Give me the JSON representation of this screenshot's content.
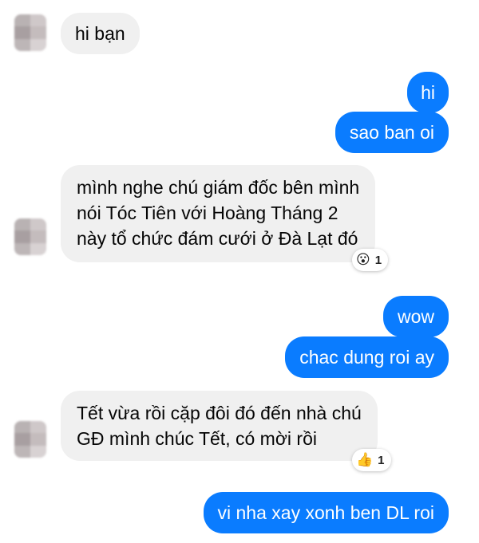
{
  "messages": [
    {
      "side": "in",
      "text": "hi bạn"
    },
    {
      "side": "out",
      "text": "hi"
    },
    {
      "side": "out",
      "text": "sao ban oi"
    },
    {
      "side": "in",
      "lines": [
        "mình nghe chú giám đốc bên mình",
        "nói Tóc Tiên với Hoàng Tháng 2",
        "này tổ chức đám cưới ở Đà Lạt đó"
      ],
      "reaction": {
        "icon": "surprised-face-icon",
        "emoji": "😮",
        "count": "1"
      }
    },
    {
      "side": "out",
      "text": "wow"
    },
    {
      "side": "out",
      "text": "chac dung roi ay"
    },
    {
      "side": "in",
      "lines": [
        "Tết vừa rồi cặp đôi đó đến nhà chú",
        "GĐ mình chúc Tết, có mời rồi"
      ],
      "reaction": {
        "icon": "thumbs-up-icon",
        "emoji": "👍",
        "count": "1"
      }
    },
    {
      "side": "out",
      "text": "vi nha xay xonh ben DL roi"
    }
  ],
  "colors": {
    "outgoing_bubble": "#0a7cff",
    "incoming_bubble": "#f0f0f0",
    "outgoing_text": "#ffffff",
    "incoming_text": "#050505"
  }
}
